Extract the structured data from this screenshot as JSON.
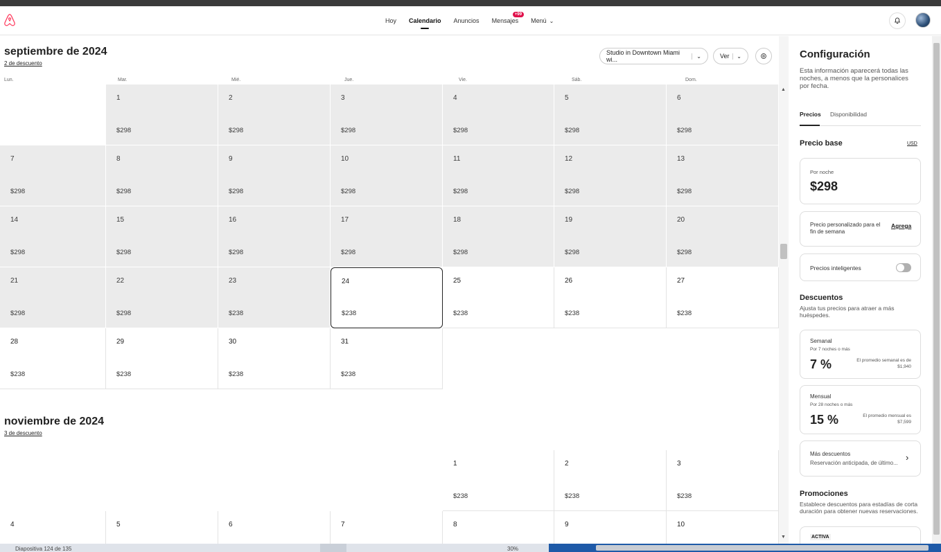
{
  "nav": {
    "items": [
      {
        "label": "Hoy",
        "active": false
      },
      {
        "label": "Calendario",
        "active": true
      },
      {
        "label": "Anuncios",
        "active": false
      },
      {
        "label": "Mensajes",
        "active": false,
        "badge": "+99"
      },
      {
        "label": "Menú",
        "active": false,
        "dropdown": true
      }
    ]
  },
  "calendar": {
    "listing_select": "Studio in Downtown Miami wi...",
    "view_select": "Ver",
    "weekdays": [
      "Lun.",
      "Mar.",
      "Mié.",
      "Jue.",
      "Vie.",
      "Sáb.",
      "Dom."
    ],
    "months": [
      {
        "title": "septiembre de 2024",
        "discount_link": "2 de descuento",
        "weeks": [
          [
            null,
            {
              "d": "1",
              "p": "$298",
              "g": true
            },
            {
              "d": "2",
              "p": "$298",
              "g": true
            },
            {
              "d": "3",
              "p": "$298",
              "g": true
            },
            {
              "d": "4",
              "p": "$298",
              "g": true
            },
            {
              "d": "5",
              "p": "$298",
              "g": true
            },
            {
              "d": "6",
              "p": "$298",
              "g": true
            }
          ],
          [
            {
              "d": "7",
              "p": "$298",
              "g": true
            },
            {
              "d": "8",
              "p": "$298",
              "g": true
            },
            {
              "d": "9",
              "p": "$298",
              "g": true
            },
            {
              "d": "10",
              "p": "$298",
              "g": true
            },
            {
              "d": "11",
              "p": "$298",
              "g": true
            },
            {
              "d": "12",
              "p": "$298",
              "g": true
            },
            {
              "d": "13",
              "p": "$298",
              "g": true
            }
          ],
          [
            {
              "d": "14",
              "p": "$298",
              "g": true
            },
            {
              "d": "15",
              "p": "$298",
              "g": true
            },
            {
              "d": "16",
              "p": "$298",
              "g": true
            },
            {
              "d": "17",
              "p": "$298",
              "g": true
            },
            {
              "d": "18",
              "p": "$298",
              "g": true
            },
            {
              "d": "19",
              "p": "$298",
              "g": true
            },
            {
              "d": "20",
              "p": "$298",
              "g": true
            }
          ],
          [
            {
              "d": "21",
              "p": "$298",
              "g": true
            },
            {
              "d": "22",
              "p": "$298",
              "g": true
            },
            {
              "d": "23",
              "p": "$238",
              "g": true
            },
            {
              "d": "24",
              "p": "$238",
              "g": false,
              "sel": true
            },
            {
              "d": "25",
              "p": "$238",
              "g": false
            },
            {
              "d": "26",
              "p": "$238",
              "g": false
            },
            {
              "d": "27",
              "p": "$238",
              "g": false
            }
          ],
          [
            {
              "d": "28",
              "p": "$238",
              "g": false
            },
            {
              "d": "29",
              "p": "$238",
              "g": false
            },
            {
              "d": "30",
              "p": "$238",
              "g": false
            },
            {
              "d": "31",
              "p": "$238",
              "g": false
            },
            null,
            null,
            null
          ]
        ]
      },
      {
        "title": "noviembre de 2024",
        "discount_link": "3 de descuento",
        "weeks": [
          [
            null,
            null,
            null,
            null,
            {
              "d": "1",
              "p": "$238",
              "g": false
            },
            {
              "d": "2",
              "p": "$238",
              "g": false
            },
            {
              "d": "3",
              "p": "$238",
              "g": false
            }
          ],
          [
            {
              "d": "4",
              "p": "",
              "g": false
            },
            {
              "d": "5",
              "p": "",
              "g": false
            },
            {
              "d": "6",
              "p": "",
              "g": false
            },
            {
              "d": "7",
              "p": "",
              "g": false
            },
            {
              "d": "8",
              "p": "",
              "g": false
            },
            {
              "d": "9",
              "p": "",
              "g": false
            },
            {
              "d": "10",
              "p": "",
              "g": false
            }
          ]
        ]
      }
    ]
  },
  "panel": {
    "title": "Configuración",
    "description": "Esta información aparecerá todas las noches, a menos que la personalices por fecha.",
    "tabs": [
      "Precios",
      "Disponibilidad"
    ],
    "base_price": {
      "title": "Precio base",
      "currency": "USD",
      "per_night_label": "Por noche",
      "per_night_value": "$298",
      "weekend_label": "Precio personalizado para el fin de semana",
      "weekend_action": "Agrega",
      "smart_label": "Precios inteligentes"
    },
    "discounts": {
      "title": "Descuentos",
      "description": "Ajusta tus precios para atraer a más huéspedes.",
      "weekly": {
        "label": "Semanal",
        "sub": "Por 7 noches o más",
        "value": "7 %",
        "avg": "El promedio semanal es de $1,940"
      },
      "monthly": {
        "label": "Mensual",
        "sub": "Por 28 noches o más",
        "value": "15 %",
        "avg": "El promedio mensual es $7,599"
      },
      "more": {
        "label": "Más descuentos",
        "sub": "Reservación anticipada, de último..."
      }
    },
    "promotions": {
      "title": "Promociones",
      "description": "Establece descuentos para estadías de corta duración para obtener nuevas reservaciones.",
      "badge": "ACTIVA"
    }
  },
  "taskbar": {
    "slide_text": "Diapositiva 124 de 135",
    "zoom_text": "30%"
  },
  "colors": {
    "brand": "#ff385c",
    "badge": "#e0114b"
  }
}
